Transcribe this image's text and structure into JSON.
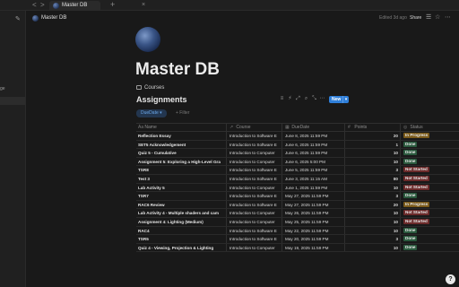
{
  "tabbar": {
    "back_icon": "<",
    "forward_icon": ">",
    "tab_title": "Master DB",
    "tab_close": "×",
    "new_tab": "+"
  },
  "sidebar": {
    "edit_icon": "✎",
    "fragment_label": "ge",
    "active_item": ""
  },
  "header": {
    "title": "Master DB",
    "edited": "Edited 3d ago",
    "share": "Share",
    "comment_icon": "☰",
    "favorite_icon": "☆",
    "more_icon": "⋯"
  },
  "page": {
    "title": "Master DB",
    "linked_course": "Courses"
  },
  "database": {
    "title": "Assignments",
    "tool_icons": [
      "≡",
      "⚡",
      "⤢",
      "⌕",
      "⤡",
      "⋯"
    ],
    "new_button": "New",
    "new_chevron": "▾",
    "filter_chip": "DueDate ▾",
    "add_filter": "+ Filter"
  },
  "table": {
    "columns": [
      {
        "icon": "Aa",
        "label": "Name"
      },
      {
        "icon": "↗",
        "label": "Course"
      },
      {
        "icon": "▦",
        "label": "DueDate"
      },
      {
        "icon": "#",
        "label": "Points"
      },
      {
        "icon": "◎",
        "label": "Status"
      }
    ],
    "rows": [
      {
        "name": "Reflection Essay",
        "course": "Introduction to Software E",
        "date": "June 8, 2025 11:59 PM",
        "points": "20",
        "status": "In Progress"
      },
      {
        "name": "SET5 Acknowledgement",
        "course": "Introduction to Software E",
        "date": "June 6, 2025 11:59 PM",
        "points": "1",
        "status": "Done"
      },
      {
        "name": "Quiz 5 - Cumulative",
        "course": "Introduction to Computer",
        "date": "June 6, 2025 11:59 PM",
        "points": "10",
        "status": "Done"
      },
      {
        "name": "Assignment 5: Exploring a High-Level Gra",
        "course": "Introduction to Computer",
        "date": "June 6, 2025 5:00 PM",
        "points": "10",
        "status": "Done"
      },
      {
        "name": "TSR8",
        "course": "Introduction to Software E",
        "date": "June 5, 2025 11:59 PM",
        "points": "3",
        "status": "Not Started"
      },
      {
        "name": "Test 3",
        "course": "Introduction to Software E",
        "date": "June 3, 2025 11:15 AM",
        "points": "80",
        "status": "Not Started"
      },
      {
        "name": "Lab Activity 5",
        "course": "Introduction to Computer",
        "date": "June 1, 2025 11:59 PM",
        "points": "10",
        "status": "Not Started"
      },
      {
        "name": "TSR7",
        "course": "Introduction to Software E",
        "date": "May 27, 2025 11:59 PM",
        "points": "3",
        "status": "Done"
      },
      {
        "name": "RAC6 Review",
        "course": "Introduction to Software E",
        "date": "May 27, 2025 11:59 PM",
        "points": "20",
        "status": "In Progress"
      },
      {
        "name": "Lab Activity 4 - Multiple shaders and cam",
        "course": "Introduction to Computer",
        "date": "May 26, 2025 11:59 PM",
        "points": "10",
        "status": "Not Started"
      },
      {
        "name": "Assignment 4: Lighting (Medium)",
        "course": "Introduction to Computer",
        "date": "May 25, 2025 11:59 PM",
        "points": "10",
        "status": "Not Started"
      },
      {
        "name": "RAC4",
        "course": "Introduction to Software E",
        "date": "May 22, 2025 11:59 PM",
        "points": "10",
        "status": "Done"
      },
      {
        "name": "TSR5",
        "course": "Introduction to Software E",
        "date": "May 20, 2025 11:59 PM",
        "points": "3",
        "status": "Done"
      },
      {
        "name": "Quiz 4 - Viewing, Projection & Lighting",
        "course": "Introduction to Computer",
        "date": "May 19, 2025 11:59 PM",
        "points": "10",
        "status": "Done"
      }
    ]
  },
  "help_button": "?",
  "colors": {
    "background": "#191919",
    "accent_blue": "#2f7fd9",
    "done": "#2b5a3e",
    "not_started": "#6b2a2a",
    "in_progress": "#7a5a1a"
  }
}
